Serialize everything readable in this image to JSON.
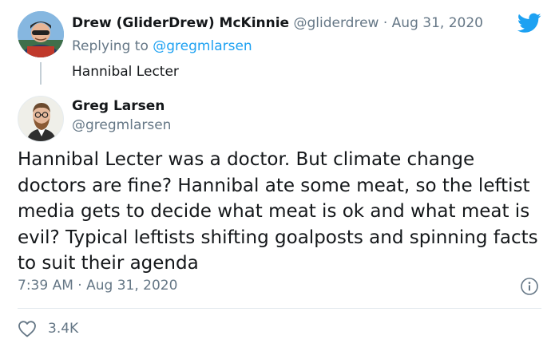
{
  "reply": {
    "author_name": "Drew (GliderDrew) McKinnie",
    "author_handle": "@gliderdrew",
    "separator": "·",
    "date": "Aug 31, 2020",
    "replying_to_prefix": "Replying to",
    "replying_to_mention": "@gregmlarsen",
    "text": "Hannibal Lecter"
  },
  "tweet": {
    "author_name": "Greg Larsen",
    "author_handle": "@gregmlarsen",
    "text": "Hannibal Lecter was a doctor. But climate change doctors are fine? Hannibal ate some meat, so the leftist media gets to decide what meat is ok and what meat is evil? Typical leftists shifting goalposts and spinning facts to suit their agenda",
    "time": "7:39 AM",
    "separator": "·",
    "date": "Aug 31, 2020",
    "likes": "3.4K"
  },
  "icons": {
    "brand": "twitter-bird-icon",
    "info": "info-icon",
    "like": "heart-icon"
  },
  "colors": {
    "brand_blue": "#1da1f2",
    "secondary_text": "#657786",
    "primary_text": "#14171a"
  }
}
